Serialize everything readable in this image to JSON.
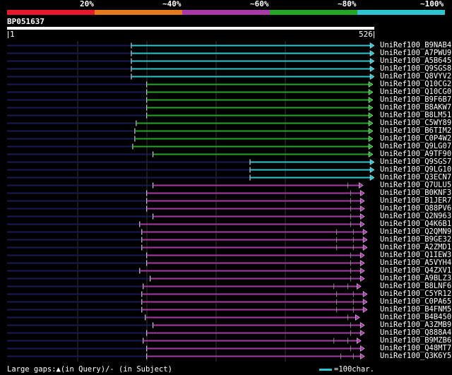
{
  "legend": {
    "segments": [
      {
        "label": "20%",
        "color": "#e8192c"
      },
      {
        "label": "~40%",
        "color": "#e87a1e"
      },
      {
        "label": "~60%",
        "color": "#a63aa8"
      },
      {
        "label": "~80%",
        "color": "#23a623"
      },
      {
        "label": "~100%",
        "color": "#2ec4d0"
      }
    ]
  },
  "query": {
    "name": "BP051637",
    "start_label": "1",
    "end_label": "526",
    "length": 526
  },
  "hits": [
    {
      "label": "UniRef100_B9NAB4",
      "start": 178,
      "end": 526,
      "color": "#2ec4d0",
      "gaps": []
    },
    {
      "label": "UniRef100_A7PWU9",
      "start": 178,
      "end": 526,
      "color": "#2ec4d0",
      "gaps": []
    },
    {
      "label": "UniRef100_A5B645",
      "start": 178,
      "end": 526,
      "color": "#2ec4d0",
      "gaps": []
    },
    {
      "label": "UniRef100_Q9SGS8",
      "start": 178,
      "end": 526,
      "color": "#2ec4d0",
      "gaps": []
    },
    {
      "label": "UniRef100_Q8VYV2",
      "start": 178,
      "end": 526,
      "color": "#2ec4d0",
      "gaps": []
    },
    {
      "label": "UniRef100_Q10CG2",
      "start": 200,
      "end": 524,
      "color": "#23a623",
      "gaps": []
    },
    {
      "label": "UniRef100_Q10CG0",
      "start": 200,
      "end": 524,
      "color": "#23a623",
      "gaps": []
    },
    {
      "label": "UniRef100_B9F6B7",
      "start": 200,
      "end": 524,
      "color": "#23a623",
      "gaps": []
    },
    {
      "label": "UniRef100_B8AKW7",
      "start": 200,
      "end": 524,
      "color": "#23a623",
      "gaps": []
    },
    {
      "label": "UniRef100_B8LM51",
      "start": 200,
      "end": 524,
      "color": "#23a623",
      "gaps": []
    },
    {
      "label": "UniRef100_C5WY89",
      "start": 185,
      "end": 524,
      "color": "#23a623",
      "gaps": []
    },
    {
      "label": "UniRef100_B6TIM2",
      "start": 183,
      "end": 524,
      "color": "#23a623",
      "gaps": []
    },
    {
      "label": "UniRef100_C0P4W2",
      "start": 183,
      "end": 524,
      "color": "#23a623",
      "gaps": []
    },
    {
      "label": "UniRef100_Q9LG07",
      "start": 180,
      "end": 524,
      "color": "#23a623",
      "gaps": []
    },
    {
      "label": "UniRef100_A9TF90",
      "start": 209,
      "end": 524,
      "color": "#23a623",
      "gaps": []
    },
    {
      "label": "UniRef100_Q9SGS7",
      "start": 348,
      "end": 526,
      "color": "#2ec4d0",
      "gaps": []
    },
    {
      "label": "UniRef100_Q9LG10",
      "start": 348,
      "end": 526,
      "color": "#2ec4d0",
      "gaps": []
    },
    {
      "label": "UniRef100_Q3ECN7",
      "start": 348,
      "end": 526,
      "color": "#2ec4d0",
      "gaps": []
    },
    {
      "label": "UniRef100_Q7ULU5",
      "start": 209,
      "end": 510,
      "color": "#a63aa8",
      "gaps": [
        488
      ]
    },
    {
      "label": "UniRef100_B0KNF3",
      "start": 200,
      "end": 512,
      "color": "#a63aa8",
      "gaps": [
        492
      ]
    },
    {
      "label": "UniRef100_B1JER7",
      "start": 200,
      "end": 512,
      "color": "#a63aa8",
      "gaps": [
        492
      ]
    },
    {
      "label": "UniRef100_Q88PV6",
      "start": 200,
      "end": 512,
      "color": "#a63aa8",
      "gaps": [
        492
      ]
    },
    {
      "label": "UniRef100_Q2N963",
      "start": 209,
      "end": 512,
      "color": "#a63aa8",
      "gaps": [
        492
      ]
    },
    {
      "label": "UniRef100_Q4K6B1",
      "start": 190,
      "end": 512,
      "color": "#a63aa8",
      "gaps": [
        492
      ]
    },
    {
      "label": "UniRef100_Q2QMN9",
      "start": 193,
      "end": 516,
      "color": "#a63aa8",
      "gaps": [
        472,
        496
      ]
    },
    {
      "label": "UniRef100_B9GE32",
      "start": 193,
      "end": 516,
      "color": "#a63aa8",
      "gaps": [
        472,
        496
      ]
    },
    {
      "label": "UniRef100_A2ZMD1",
      "start": 193,
      "end": 516,
      "color": "#a63aa8",
      "gaps": [
        472,
        496
      ]
    },
    {
      "label": "UniRef100_Q1IEW3",
      "start": 200,
      "end": 512,
      "color": "#a63aa8",
      "gaps": [
        492
      ]
    },
    {
      "label": "UniRef100_A5VYH4",
      "start": 200,
      "end": 512,
      "color": "#a63aa8",
      "gaps": [
        492
      ]
    },
    {
      "label": "UniRef100_Q4ZXV1",
      "start": 190,
      "end": 512,
      "color": "#a63aa8",
      "gaps": [
        492
      ]
    },
    {
      "label": "UniRef100_A9BLZ3",
      "start": 205,
      "end": 512,
      "color": "#a63aa8",
      "gaps": [
        492
      ]
    },
    {
      "label": "UniRef100_B8LNF6",
      "start": 195,
      "end": 507,
      "color": "#a63aa8",
      "gaps": [
        468,
        488
      ]
    },
    {
      "label": "UniRef100_C5YR12",
      "start": 193,
      "end": 516,
      "color": "#a63aa8",
      "gaps": [
        472,
        496
      ]
    },
    {
      "label": "UniRef100_C0PA65",
      "start": 193,
      "end": 516,
      "color": "#a63aa8",
      "gaps": [
        472,
        496
      ]
    },
    {
      "label": "UniRef100_B4FNM5",
      "start": 193,
      "end": 516,
      "color": "#a63aa8",
      "gaps": [
        472,
        496
      ]
    },
    {
      "label": "UniRef100_B4B450",
      "start": 198,
      "end": 505,
      "color": "#a63aa8",
      "gaps": [
        488
      ]
    },
    {
      "label": "UniRef100_A3ZMB9",
      "start": 209,
      "end": 512,
      "color": "#a63aa8",
      "gaps": [
        492
      ]
    },
    {
      "label": "UniRef100_Q888A4",
      "start": 200,
      "end": 512,
      "color": "#a63aa8",
      "gaps": [
        492
      ]
    },
    {
      "label": "UniRef100_B9MZB6",
      "start": 195,
      "end": 507,
      "color": "#a63aa8",
      "gaps": [
        468,
        488
      ]
    },
    {
      "label": "UniRef100_Q48MT7",
      "start": 200,
      "end": 512,
      "color": "#a63aa8",
      "gaps": [
        492
      ]
    },
    {
      "label": "UniRef100_Q3K6Y5",
      "start": 200,
      "end": 512,
      "color": "#a63aa8",
      "gaps": [
        478,
        496
      ]
    }
  ],
  "footer": {
    "gaps_note": "Large gaps:▲(in Query)/- (in Subject)",
    "scale_label": "=100char."
  }
}
